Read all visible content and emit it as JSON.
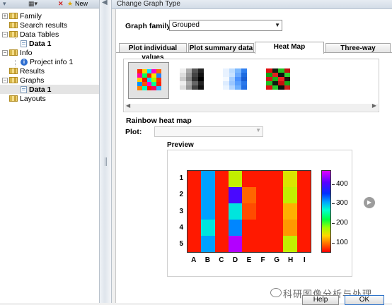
{
  "toolbar": {
    "new_label": "New"
  },
  "navigator": {
    "items": [
      {
        "label": "Family"
      },
      {
        "label": "Search results"
      },
      {
        "label": "Data Tables"
      },
      {
        "label": "Data 1"
      },
      {
        "label": "Info"
      },
      {
        "label": "Project info 1"
      },
      {
        "label": "Results"
      },
      {
        "label": "Graphs"
      },
      {
        "label": "Data 1"
      },
      {
        "label": "Layouts"
      }
    ]
  },
  "dialog": {
    "title": "Change Graph Type",
    "family_label": "Graph family:",
    "family_value": "Grouped",
    "tabs": [
      {
        "label": "Plot individual values"
      },
      {
        "label": "Plot summary data"
      },
      {
        "label": "Heat Map"
      },
      {
        "label": "Three-way"
      }
    ],
    "active_tab": "Heat Map",
    "thumbnails": [
      "rainbow-heatmap-icon",
      "grayscale-heatmap-icon",
      "blue-heatmap-icon",
      "red-green-heatmap-icon"
    ],
    "selected_thumbnail": "rainbow-heatmap-icon",
    "heatmap_type_label": "Rainbow heat map",
    "plot_label": "Plot:",
    "plot_value": "",
    "preview_label": "Preview",
    "buttons": {
      "help": "Help",
      "ok": "OK"
    }
  },
  "watermark": "科研图像分析与处理",
  "chart_data": {
    "type": "heatmap",
    "rows": [
      "1",
      "2",
      "3",
      "4",
      "5"
    ],
    "columns": [
      "A",
      "B",
      "C",
      "D",
      "E",
      "F",
      "G",
      "H",
      "I"
    ],
    "values": [
      [
        60,
        310,
        60,
        160,
        60,
        60,
        60,
        150,
        60
      ],
      [
        60,
        310,
        60,
        400,
        90,
        60,
        60,
        160,
        60
      ],
      [
        60,
        310,
        60,
        280,
        80,
        60,
        60,
        120,
        60
      ],
      [
        60,
        280,
        60,
        320,
        60,
        60,
        60,
        110,
        60
      ],
      [
        60,
        310,
        60,
        450,
        60,
        60,
        60,
        160,
        60
      ]
    ],
    "colorbar_ticks": [
      400,
      300,
      200,
      100
    ],
    "colorbar_range": [
      50,
      470
    ],
    "colormap": "rainbow"
  }
}
